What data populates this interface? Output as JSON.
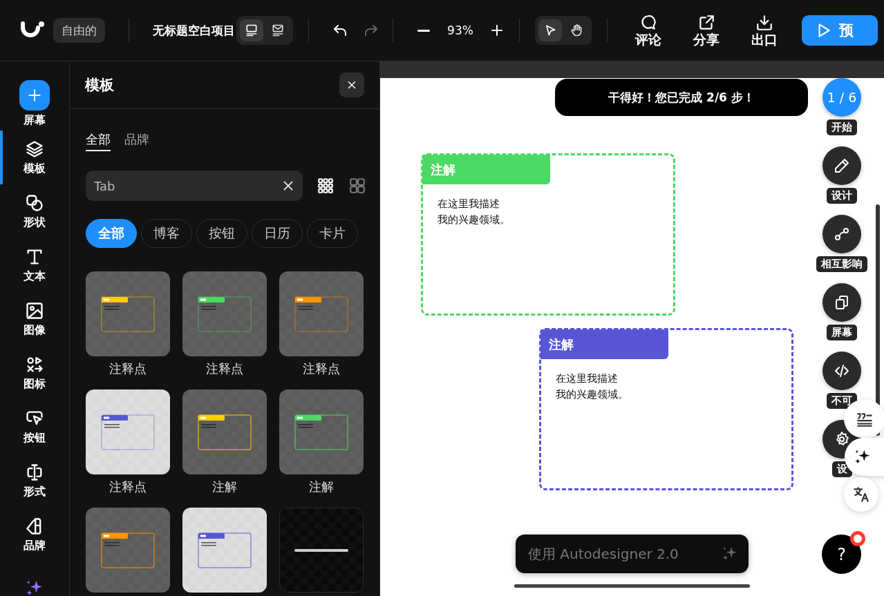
{
  "topbar": {
    "mode_badge": "自由的",
    "project_title": "无标题空白项目",
    "view_toggle": [
      {
        "selected": true
      },
      {
        "selected": false
      }
    ],
    "undo": {
      "disabled": false
    },
    "redo": {
      "disabled": true
    },
    "zoom": "93%",
    "tools": [
      {
        "selected": true
      },
      {
        "selected": false
      }
    ],
    "actions": [
      {
        "label": "评论"
      },
      {
        "label": "分享"
      },
      {
        "label": "出口"
      }
    ],
    "preview_button": "预"
  },
  "rail": {
    "items": [
      {
        "kind": "add",
        "label": "屏幕",
        "selected": false
      },
      {
        "kind": "tool",
        "label": "模板",
        "selected": true
      },
      {
        "kind": "tool",
        "label": "形状",
        "selected": false
      },
      {
        "kind": "tool",
        "label": "文本",
        "selected": false
      },
      {
        "kind": "tool",
        "label": "图像",
        "selected": false
      },
      {
        "kind": "tool",
        "label": "图标",
        "selected": false
      },
      {
        "kind": "tool",
        "label": "按钮",
        "selected": false
      },
      {
        "kind": "tool",
        "label": "形式",
        "selected": false
      },
      {
        "kind": "tool",
        "label": "品牌",
        "selected": false
      },
      {
        "kind": "ai",
        "selected": false
      }
    ]
  },
  "panel": {
    "title": "模板",
    "tabs": [
      {
        "label": "全部",
        "selected": true
      },
      {
        "label": "品牌",
        "selected": false
      }
    ],
    "search": {
      "value": "Tab"
    },
    "layout_toggle": [
      {
        "selected": true
      },
      {
        "selected": false
      }
    ],
    "chips": [
      {
        "label": "全部",
        "selected": true
      },
      {
        "label": "博客",
        "selected": false
      },
      {
        "label": "按钮",
        "selected": false
      },
      {
        "label": "日历",
        "selected": false
      },
      {
        "label": "卡片",
        "selected": false
      }
    ],
    "templates": [
      {
        "kind": "annotation",
        "label": "注释点",
        "light": false,
        "color": "#ffcc00",
        "dashed": true
      },
      {
        "kind": "annotation",
        "label": "注释点",
        "light": false,
        "color": "#4cd964",
        "dashed": true
      },
      {
        "kind": "annotation",
        "label": "注释点",
        "light": false,
        "color": "#ff9500",
        "dashed": true
      },
      {
        "kind": "annotation",
        "label": "注释点",
        "light": true,
        "color": "#5856d6",
        "dashed": true
      },
      {
        "kind": "annotation",
        "label": "注解",
        "light": false,
        "color": "#ffcc00",
        "dashed": false
      },
      {
        "kind": "annotation",
        "label": "注解",
        "light": false,
        "color": "#4cd964",
        "dashed": false
      },
      {
        "kind": "annotation",
        "light": false,
        "color": "#ff9500",
        "dashed": false
      },
      {
        "kind": "annotation",
        "light": true,
        "color": "#5856d6",
        "dashed": false
      },
      {
        "kind": "line"
      }
    ]
  },
  "canvas": {
    "progress_message": "干得好！您已完成 2/6 步！",
    "annotations": [
      {
        "title": "注解",
        "lines": [
          "在这里我描述",
          "我的兴趣领域。"
        ],
        "color": "#4cd964"
      },
      {
        "title": "注解",
        "lines": [
          "在这里我描述",
          "我的兴趣领域。"
        ],
        "color": "#5856d6"
      }
    ],
    "steps": [
      {
        "kind": "number",
        "number": "1 / 6",
        "label": "开始",
        "selected": true
      },
      {
        "kind": "icon",
        "label": "设计",
        "selected": false
      },
      {
        "kind": "icon",
        "label": "相互影响",
        "selected": false
      },
      {
        "kind": "icon",
        "label": "屏幕",
        "selected": false
      },
      {
        "kind": "icon",
        "label": "不可",
        "selected": false
      },
      {
        "kind": "icon",
        "label": "设",
        "selected": false
      }
    ],
    "assistant": {
      "placeholder": "使用 Autodesigner 2.0"
    },
    "help": {
      "label": "?",
      "notification": true
    }
  }
}
